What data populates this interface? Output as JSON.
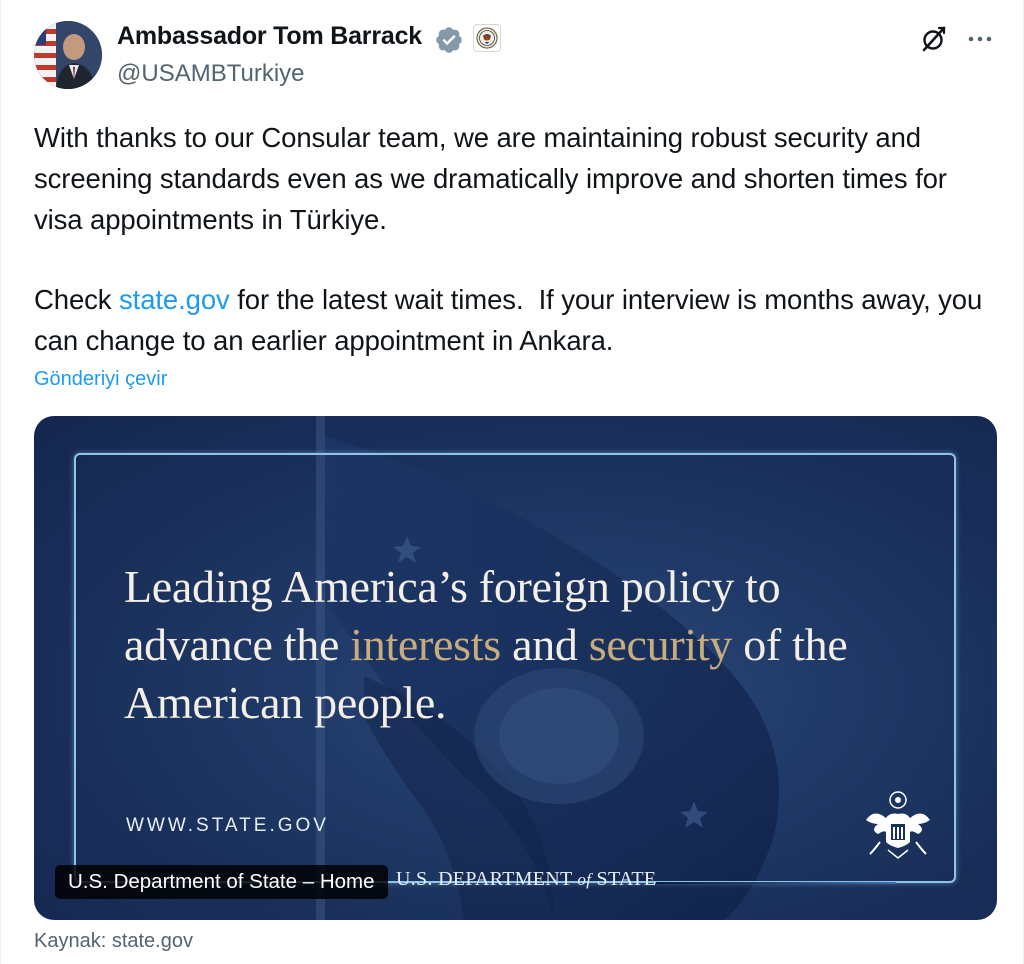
{
  "author": {
    "name": "Ambassador Tom Barrack",
    "handle": "@USAMBTurkiye"
  },
  "tweet": {
    "paragraph1": "With thanks to our Consular team, we are maintaining robust security and screening standards even as we dramatically improve and shorten times for visa appointments in Türkiye.",
    "p2_before": "Check ",
    "p2_link": "state.gov",
    "p2_after": " for the latest wait times.  If your interview is months away, you can change to an earlier appointment in Ankara.",
    "translate_label": "Gönderiyi çevir"
  },
  "card": {
    "quote_l1": "Leading America’s foreign policy to",
    "quote_l2a": "advance the ",
    "quote_l2_gold1": "interests",
    "quote_l2b": " and ",
    "quote_l2_gold2": "security",
    "quote_l2c": " of the",
    "quote_l3": "American people.",
    "site_url": "WWW.STATE.GOV",
    "dept_a": "U.S. DEPARTMENT ",
    "dept_of": "of",
    "dept_b": " STATE",
    "label": "U.S. Department of State – Home"
  },
  "source_label": "Kaynak: state.gov",
  "icons": {
    "verified": "verified-badge-icon",
    "seal": "state-department-seal-icon",
    "grok": "grok-icon",
    "more": "more-options-icon",
    "eagle": "eagle-seal-icon"
  },
  "colors": {
    "link": "#1d9bf0",
    "secondary_text": "#536471",
    "verified_badge": "#829aab",
    "card_navy": "#1a315e",
    "accent_gold": "#c8ac7c"
  }
}
